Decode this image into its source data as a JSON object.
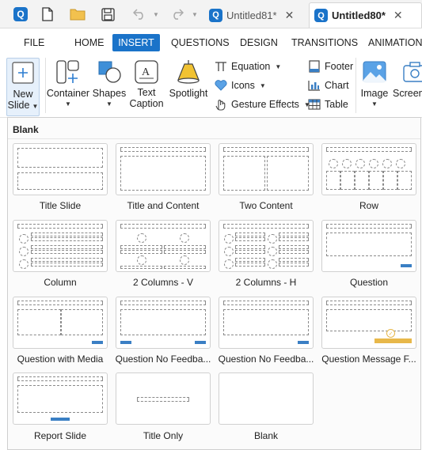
{
  "titlebar": {
    "tabs": [
      {
        "title": "Untitled81*",
        "active": false
      },
      {
        "title": "Untitled80*",
        "active": true
      }
    ],
    "close_glyph": "✕"
  },
  "menu": {
    "tabs": [
      "FILE",
      "HOME",
      "INSERT",
      "QUESTIONS",
      "DESIGN",
      "TRANSITIONS",
      "ANIMATIONS"
    ],
    "active": "INSERT"
  },
  "ribbon": {
    "new_slide": {
      "line1": "New",
      "line2": "Slide"
    },
    "container": "Container",
    "shapes": "Shapes",
    "text_caption": {
      "line1": "Text",
      "line2": "Caption"
    },
    "spotlight": "Spotlight",
    "equation": "Equation",
    "icons": "Icons",
    "gesture_effects": "Gesture Effects",
    "footer": "Footer",
    "chart": "Chart",
    "table": "Table",
    "image": "Image",
    "screenshot": "Screens"
  },
  "gallery": {
    "header": "Blank",
    "layouts": [
      "Title Slide",
      "Title and Content",
      "Two Content",
      "Row",
      "Column",
      "2 Columns - V",
      "2 Columns - H",
      "Question",
      "Question with Media",
      "Question No Feedba...",
      "Question No Feedba...",
      "Question Message F...",
      "Report Slide",
      "Title Only",
      "Blank"
    ]
  },
  "colors": {
    "accent": "#1a73c9",
    "placeholder_blue": "#3a7fc4",
    "placeholder_gold": "#e8b84a"
  }
}
